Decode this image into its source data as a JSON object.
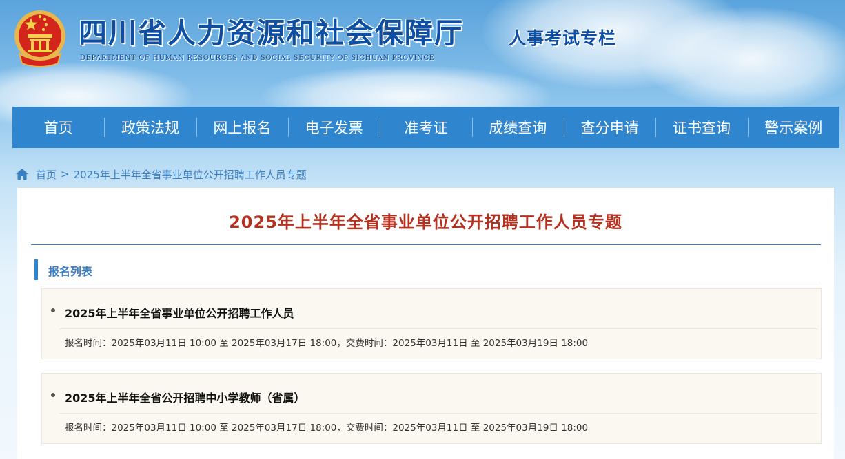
{
  "header": {
    "title": "四川省人力资源和社会保障厅",
    "subtitle": "DEPARTMENT OF HUMAN RESOURCES AND SOCIAL SECURITY OF SICHUAN PROVINCE",
    "column_name": "人事考试专栏",
    "emblem_icon": "national-emblem-icon"
  },
  "nav": {
    "items": [
      {
        "label": "首页"
      },
      {
        "label": "政策法规"
      },
      {
        "label": "网上报名"
      },
      {
        "label": "电子发票"
      },
      {
        "label": "准考证"
      },
      {
        "label": "成绩查询"
      },
      {
        "label": "查分申请"
      },
      {
        "label": "证书查询"
      },
      {
        "label": "警示案例"
      }
    ]
  },
  "breadcrumb": {
    "home_icon": "home-icon",
    "home": "首页",
    "separator": ">",
    "current": "2025年上半年全省事业单位公开招聘工作人员专题"
  },
  "main": {
    "title": "2025年上半年全省事业单位公开招聘工作人员专题",
    "section_label": "报名列表",
    "cards": [
      {
        "title": "2025年上半年全省事业单位公开招聘工作人员",
        "meta": "报名时间：2025年03月11日 10:00 至 2025年03月17日 18:00，交费时间：2025年03月11日 至 2025年03月19日 18:00"
      },
      {
        "title": "2025年上半年全省公开招聘中小学教师（省属）",
        "meta": "报名时间：2025年03月11日 10:00 至 2025年03月17日 18:00，交费时间：2025年03月11日 至 2025年03月19日 18:00"
      }
    ]
  },
  "colors": {
    "nav_bg": "#2f86cf",
    "title_red": "#b5311f",
    "link_blue": "#3b7fc4",
    "brand_blue": "#0e4ea3",
    "card_bg": "#fbf8f1"
  }
}
